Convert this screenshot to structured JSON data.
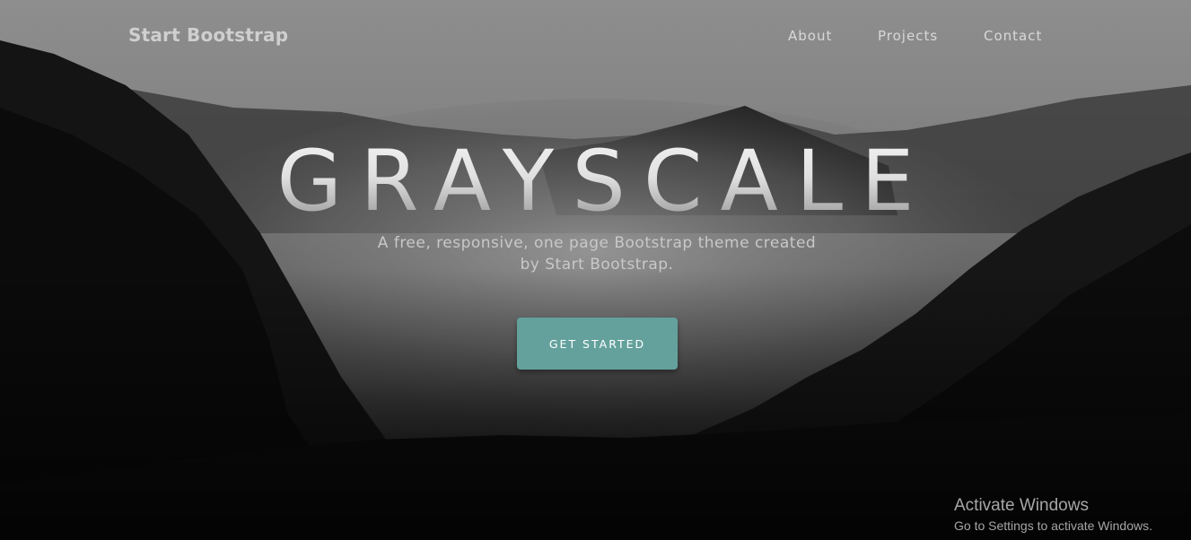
{
  "navbar": {
    "brand": "Start Bootstrap",
    "links": [
      {
        "label": "About"
      },
      {
        "label": "Projects"
      },
      {
        "label": "Contact"
      }
    ]
  },
  "hero": {
    "title": "GRAYSCALE",
    "subtitle": "A free, responsive, one page Bootstrap theme created by Start Bootstrap.",
    "cta_label": "Get Started"
  },
  "watermark": {
    "title": "Activate Windows",
    "subtitle": "Go to Settings to activate Windows."
  },
  "colors": {
    "accent": "#64a19d",
    "nav_text": "#d8d8d8",
    "brand_text": "#cfcfcf",
    "watermark_text": "#a6a6a6"
  }
}
